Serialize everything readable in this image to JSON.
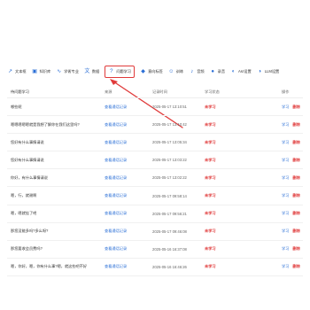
{
  "toolbar": {
    "items": [
      {
        "icon": "trend-icon",
        "label": "文本框"
      },
      {
        "icon": "book-icon",
        "label": "知识库"
      },
      {
        "icon": "chart-icon",
        "label": "学術专业"
      },
      {
        "icon": "translate-icon",
        "label": "数据"
      },
      {
        "icon": "question-icon",
        "label": "问题学习"
      },
      {
        "icon": "tag-icon",
        "label": "意向标签"
      },
      {
        "icon": "robot-icon",
        "label": "训练"
      },
      {
        "icon": "volume-icon",
        "label": "音频"
      },
      {
        "icon": "mic-icon",
        "label": "录音"
      },
      {
        "icon": "asr-icon",
        "label": "Asr设置"
      },
      {
        "icon": "llm-icon",
        "label": "LLM设置"
      }
    ]
  },
  "table": {
    "headers": {
      "question": "待问题学习",
      "source": "来源",
      "time": "记录时间",
      "status": "学习状态",
      "ops": "操作"
    },
    "rows": [
      {
        "question": "哪些呢",
        "source": "查看通话记录",
        "time": "2025-05-17 13:10:51",
        "status": "未学习",
        "learn": "学习",
        "delete": "删除"
      },
      {
        "question": "嗯嗯嗯嗯嗯就是我想了解你在我们这里吗?",
        "source": "查看通话记录",
        "time": "2025-05-17 13:10:42",
        "status": "未学习",
        "learn": "学习",
        "delete": "删除"
      },
      {
        "question": "您好有什么事情请说",
        "source": "查看通话记录",
        "time": "2025-05-17 13:05:34",
        "status": "未学习",
        "learn": "学习",
        "delete": "删除"
      },
      {
        "question": "您好有什么事情请说",
        "source": "查看通话记录",
        "time": "2025-05-17 13:03:22",
        "status": "未学习",
        "learn": "学习",
        "delete": "删除"
      },
      {
        "question": "你好，有什么事情请说",
        "source": "查看通话记录",
        "time": "2025-05-17 13:02:22",
        "status": "未学习",
        "learn": "学习",
        "delete": "删除"
      },
      {
        "question": "嗯，行，就谢啊",
        "source": "查看通话记录",
        "time": "2025-05-17 09:58:14",
        "status": "未学习",
        "learn": "学习",
        "delete": "删除"
      },
      {
        "question": "嗯，嗯就挂了吧",
        "source": "查看通话记录",
        "time": "2025-05-17 09:56:21",
        "status": "未学习",
        "learn": "学习",
        "delete": "删除"
      },
      {
        "question": "那您没能多吗?多么呀?",
        "source": "查看通话记录",
        "time": "2025-05-17 09:46:08",
        "status": "未学习",
        "learn": "学习",
        "delete": "删除"
      },
      {
        "question": "那您要收会员费吗?",
        "source": "查看通话记录",
        "time": "2025-05-16 16:37:08",
        "status": "未学习",
        "learn": "学习",
        "delete": "删除"
      },
      {
        "question": "嗯，你好，嗯，你有什么事?嗯，就这些吧不好",
        "source": "查看通话记录",
        "time": "2025-05-16 16:46:26",
        "status": "未学习",
        "learn": "学习",
        "delete": "删除"
      }
    ]
  },
  "colors": {
    "accent": "#2b6fd6",
    "danger": "#e03a3a"
  }
}
